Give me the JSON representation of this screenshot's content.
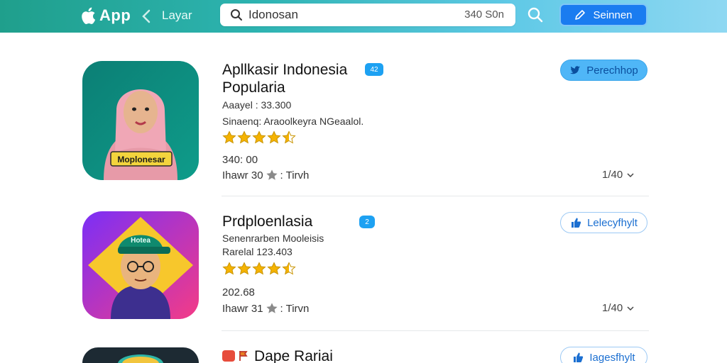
{
  "header": {
    "brand_label": "App",
    "layar_label": "Layar",
    "search_value": "Idonosan",
    "search_count": "340 S0n",
    "signin_label": "Seinnen"
  },
  "apps": [
    {
      "title_line1": "Apllkasir Indonesia",
      "title_line2": "Popularia",
      "badge": "42",
      "meta1": "Aaayel : 33.300",
      "meta2": "Sinaenq: Araoolkeyra NGeaalol.",
      "rating": 4.5,
      "price": "340: 00",
      "rating_line_prefix": "Ihawr 30",
      "rating_line_suffix": ": Tirvh",
      "pager": "1/40",
      "action_label": "Perechhop",
      "icon_caption": "Moplonesar"
    },
    {
      "title_line1": "Prdploenlasia",
      "badge": "2",
      "meta1": "Senenrarben Mooleisis",
      "meta2": "Rarelal 123.403",
      "rating": 4.5,
      "price": "202.68",
      "rating_line_prefix": "Ihawr 31",
      "rating_line_suffix": ": Tirvn",
      "pager": "1/40",
      "action_label": "Lelecyfhylt",
      "icon_caption": "Hotea"
    },
    {
      "title_line1": "Dape Rariai",
      "action_label": "Iagesfhylt"
    }
  ],
  "colors": {
    "header_start": "#1f9f8c",
    "header_end": "#8fd8f2",
    "accent": "#1a7cf0",
    "star": "#f5b301"
  }
}
